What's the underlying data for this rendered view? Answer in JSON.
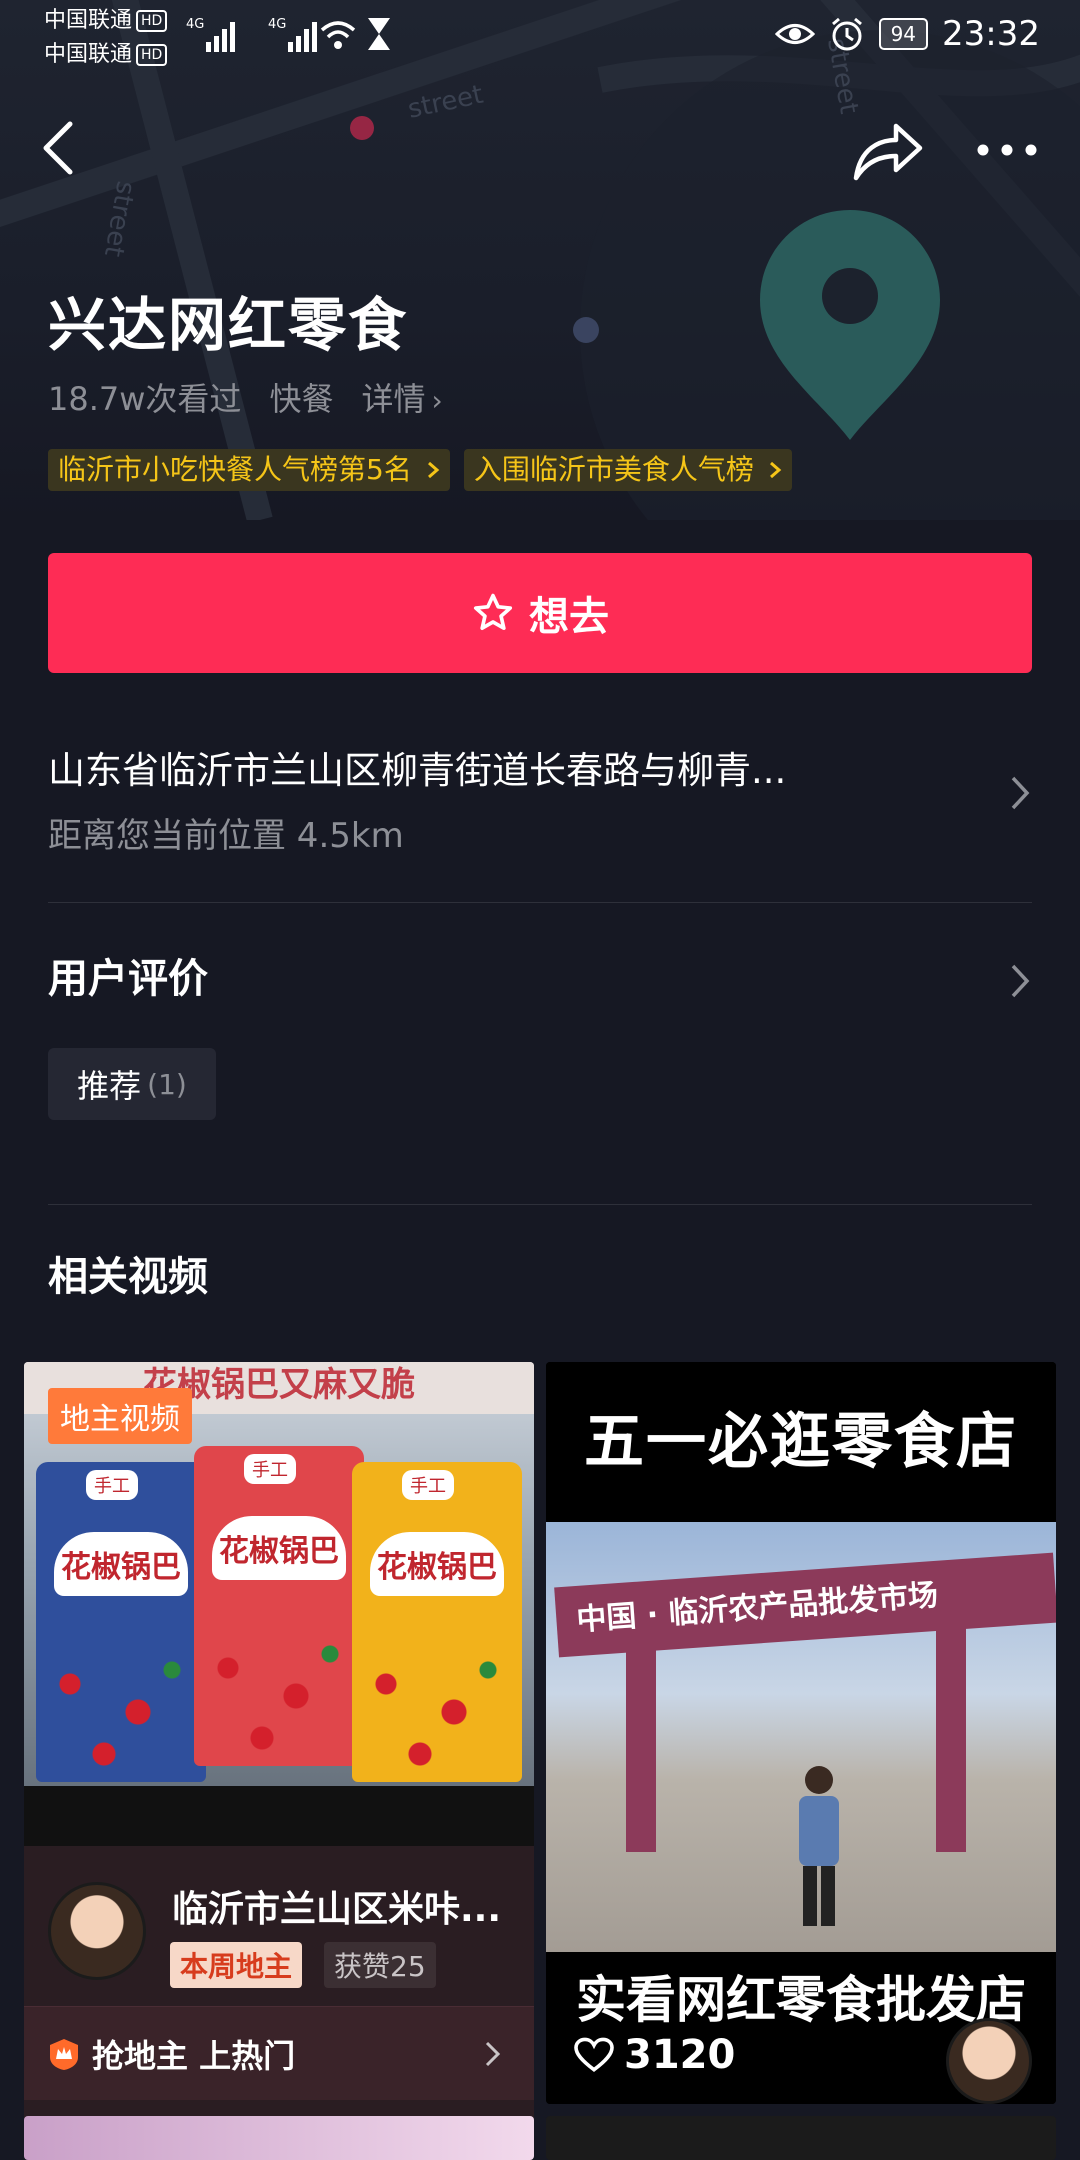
{
  "status_bar": {
    "carrier_1": "中国联通",
    "carrier_2": "中国联通",
    "hd": "HD",
    "network": "4G",
    "battery": "94",
    "time": "23:32"
  },
  "map_labels": {
    "street_1": "street",
    "street_2": "street",
    "street_3": "street"
  },
  "shop": {
    "name": "兴达网红零食",
    "views": "18.7w次看过",
    "category": "快餐",
    "details_link": "详情",
    "badges": [
      {
        "label": "临沂市小吃快餐人气榜第5名"
      },
      {
        "label": "入围临沂市美食人气榜"
      }
    ]
  },
  "want_button": {
    "label": "想去"
  },
  "address": {
    "text": "山东省临沂市兰山区柳青街道长春路与柳青...",
    "distance": "距离您当前位置 4.5km"
  },
  "reviews": {
    "title": "用户评价",
    "tags": [
      {
        "label": "推荐",
        "count": "(1)"
      }
    ]
  },
  "related_videos": {
    "title": "相关视频",
    "videos": [
      {
        "top_strip": "花椒锅巴又麻又脆",
        "host_tag": "地主视频",
        "bags": [
          {
            "sub": "手工",
            "label": "花椒锅巴",
            "color": "#2f4f9c"
          },
          {
            "sub": "手工",
            "label": "花椒锅巴",
            "color": "#e0464b"
          },
          {
            "sub": "手工",
            "label": "花椒锅巴",
            "color": "#f2b21b"
          }
        ],
        "author": "临沂市兰山区米咔...",
        "weekly_tag": "本周地主",
        "likes_tag": "获赞25",
        "grab_label": "抢地主 上热门"
      },
      {
        "headline": "五一必逛零食店",
        "arch_text": "中国 · 临沂农产品批发市场",
        "caption": "实看网红零食批发店",
        "likes": "3120"
      }
    ]
  },
  "colors": {
    "background": "#161823",
    "accent": "#fe2c55",
    "badge_text": "#f5c518",
    "muted": "#8d8f96"
  },
  "icons": [
    "back-arrow-icon",
    "share-icon",
    "more-icon",
    "star-icon",
    "chevron-right-icon",
    "heart-icon",
    "crown-icon",
    "location-pin-icon"
  ]
}
